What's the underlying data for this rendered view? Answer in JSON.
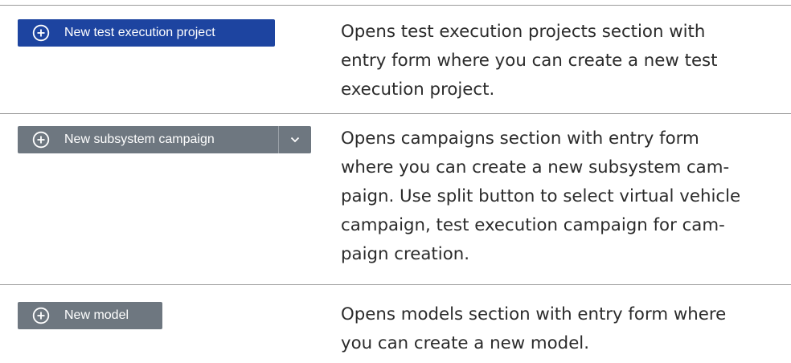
{
  "rows": [
    {
      "button_label": "New test execution project",
      "button_icon": "plus-circle-icon",
      "button_color": "#1d44a0",
      "description_lines": [
        "Opens test execution projects section with",
        "entry form where you can create a new test",
        "execution project."
      ]
    },
    {
      "button_label": "New subsystem campaign",
      "button_icon": "plus-circle-icon",
      "toggle_icon": "chevron-down-icon",
      "button_color": "#6e7780",
      "description_lines": [
        "Opens campaigns section with entry form",
        "where you can create a new subsystem cam-",
        "paign. Use split button to select virtual vehicle",
        "campaign, test execution campaign for cam-",
        "paign creation."
      ]
    },
    {
      "button_label": "New model",
      "button_icon": "plus-circle-icon",
      "button_color": "#6e7780",
      "description_lines": [
        "Opens models section with entry form where",
        "you can create a new model."
      ]
    }
  ]
}
